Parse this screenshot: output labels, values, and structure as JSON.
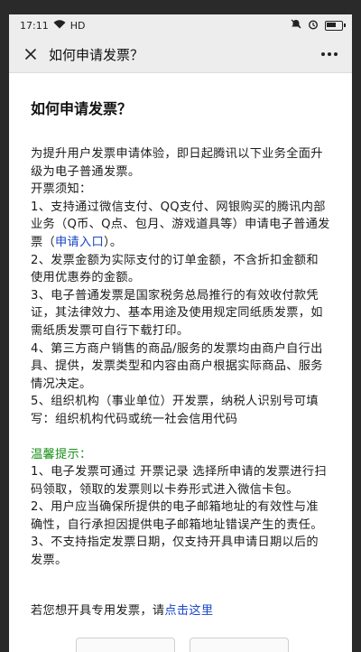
{
  "status": {
    "time": "17:11",
    "network": "HD"
  },
  "navbar": {
    "title": "如何申请发票？"
  },
  "page": {
    "heading": "如何申请发票？",
    "intro": "为提升用户发票申请体验，即日起腾讯以下业务全面升级为电子普通发票。",
    "notes_title": "开票须知：",
    "note1_prefix": "1、支持通过微信支付、QQ支付、网银购买的腾讯内部业务（Q币、Q点、包月、游戏道具等）申请电子普通发票（",
    "note1_link": "申请入口",
    "note1_suffix": "）。",
    "note2": "2、发票金额为实际支付的订单金额，不含折扣金额和使用优惠券的金额。",
    "note3": "3、电子普通发票是国家税务总局推行的有效收付款凭证，其法律效力、基本用途及使用规定同纸质发票，如需纸质发票可自行下载打印。",
    "note4": "4、第三方商户销售的商品/服务的发票均由商户自行出具、提供，发票类型和内容由商户根据实际商品、服务情况决定。",
    "note5": "5、组织机构（事业单位）开发票，纳税人识别号可填写：组织机构代码或统一社会信用代码",
    "tips_title": "温馨提示：",
    "tip1": "1、电子发票可通过 开票记录 选择所申请的发票进行扫码领取，领取的发票则以卡券形式进入微信卡包。",
    "tip2": "2、用户应当确保所提供的电子邮箱地址的有效性与准确性，自行承担因提供电子邮箱地址错误产生的责任。",
    "tip3": "3、不支持指定发票日期，仅支持开具申请日期以后的发票。",
    "footer_prefix": "若您想开具专用发票，请",
    "footer_link": "点击这里"
  },
  "colors": {
    "link": "#1a47c8",
    "tips": "#1a8f1a",
    "bar": "#ededed"
  }
}
